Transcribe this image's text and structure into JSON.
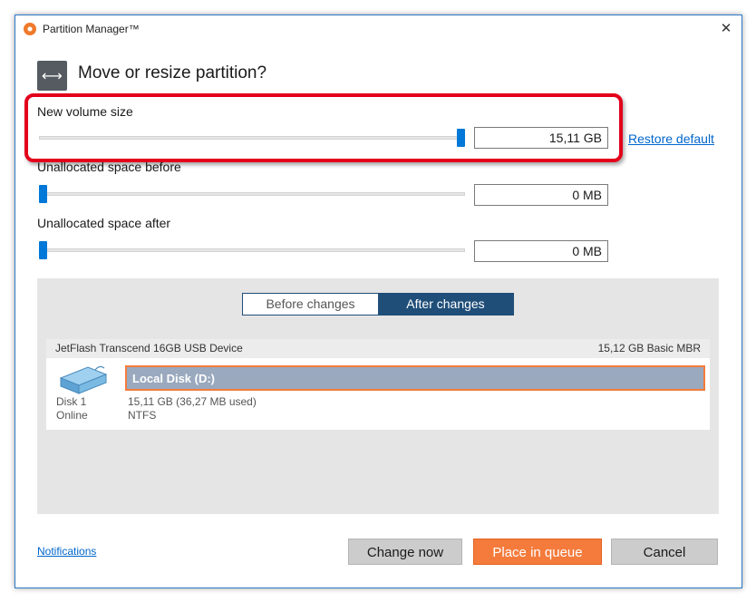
{
  "window": {
    "title": "Partition Manager™",
    "close_glyph": "✕"
  },
  "dialog": {
    "title": "Move or resize partition?",
    "icon": "resize-arrows-icon",
    "icon_glyph": "⟷"
  },
  "fields": [
    {
      "label": "New volume size",
      "value": "15,11 GB",
      "slider_fraction": 1.0
    },
    {
      "label": "Unallocated space before",
      "value": "0 MB",
      "slider_fraction": 0.0
    },
    {
      "label": "Unallocated space after",
      "value": "0 MB",
      "slider_fraction": 0.0
    }
  ],
  "restore_default": "Restore default",
  "preview": {
    "tabs": {
      "before": "Before changes",
      "after": "After changes"
    },
    "selected_tab": "after",
    "device": {
      "name": "JetFlash Transcend 16GB USB Device",
      "info": "15,12 GB Basic MBR",
      "disk_label": "Disk 1",
      "disk_status": "Online",
      "partition": {
        "name": "Local Disk (D:)",
        "size": "15,11 GB (36,27 MB used)",
        "fs": "NTFS"
      }
    }
  },
  "footer": {
    "notifications": "Notifications",
    "buttons": {
      "change_now": "Change now",
      "place_in_queue": "Place in queue",
      "cancel": "Cancel"
    }
  },
  "colors": {
    "accent": "#0078d7",
    "orange": "#f47b3c",
    "navy": "#1f4e79",
    "highlight": "#e3001b",
    "partition_fill": "#9aa9be"
  }
}
